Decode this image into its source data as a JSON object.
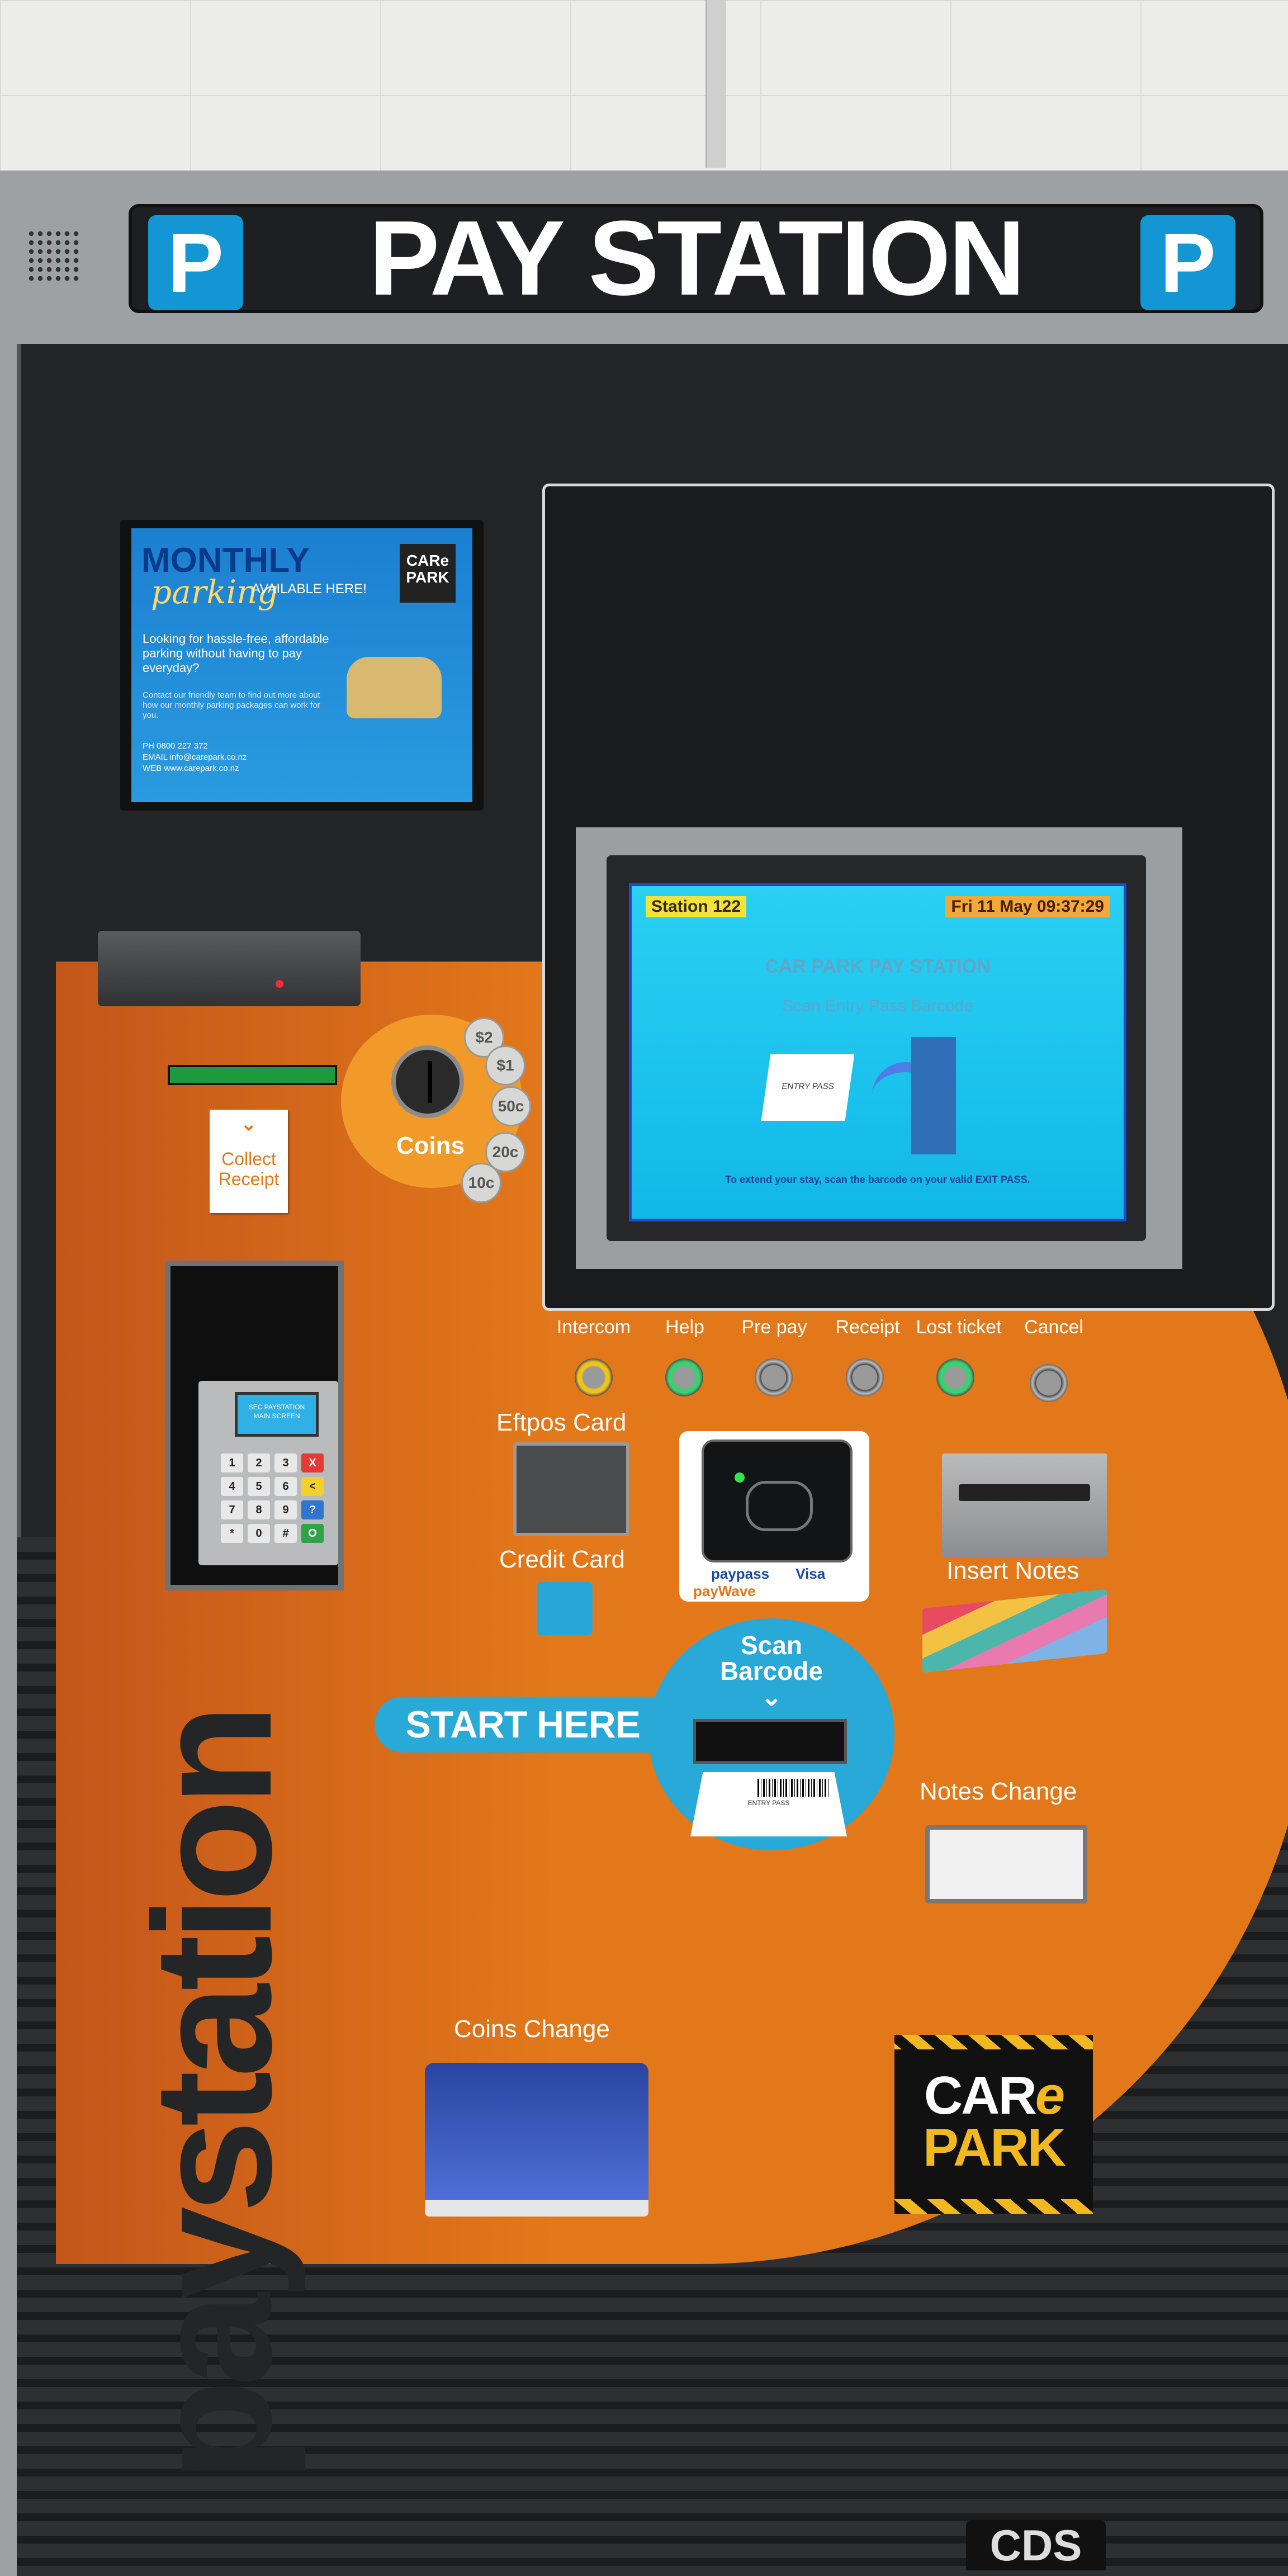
{
  "header": {
    "title": "PAY STATION",
    "parking_symbol": "P"
  },
  "ad": {
    "monthly": "MONTHLY",
    "parking": "parking",
    "available": "AVAILABLE HERE!",
    "logo_line1": "CARe",
    "logo_line2": "PARK",
    "question": "Looking for hassle-free, affordable parking without having to pay everyday?",
    "body": "Contact our friendly team to find out more about how our monthly parking packages can work for you.",
    "phone": "PH 0800 227 372",
    "email": "EMAIL info@carepark.co.nz",
    "web": "WEB www.carepark.co.nz"
  },
  "screen": {
    "station": "Station 122",
    "datetime": "Fri 11 May 09:37:29",
    "title": "CAR PARK PAY STATION",
    "instruction": "Scan Entry Pass Barcode",
    "ticket_text": "ENTRY PASS",
    "footer": "To extend your stay, scan the barcode on your valid EXIT PASS."
  },
  "coins": {
    "label": "Coins",
    "denominations": [
      "$2",
      "$1",
      "50c",
      "20c",
      "10c"
    ]
  },
  "receipt": {
    "label_line1": "Collect",
    "label_line2": "Receipt"
  },
  "keypad": {
    "screen_line1": "SEC PAYSTATION",
    "screen_line2": "MAIN SCREEN",
    "keys": [
      "1",
      "2",
      "3",
      "X",
      "4",
      "5",
      "6",
      "<",
      "7",
      "8",
      "9",
      "?",
      "*",
      "0",
      "#",
      "O"
    ]
  },
  "buttons": [
    {
      "label": "Intercom",
      "icon": "intercom-icon"
    },
    {
      "label": "Help",
      "icon": "help-icon"
    },
    {
      "label": "Pre pay",
      "icon": "prepay-icon"
    },
    {
      "label": "Receipt",
      "icon": "receipt-icon"
    },
    {
      "label": "Lost ticket",
      "icon": "lost-ticket-icon"
    },
    {
      "label": "Cancel",
      "icon": "cancel-icon"
    }
  ],
  "payment": {
    "eftpos": "Eftpos Card",
    "credit": "Credit Card",
    "paypass": "paypass",
    "visa": "Visa",
    "paywave": "payWave",
    "insert_notes": "Insert Notes",
    "notes_change": "Notes Change",
    "coins_change": "Coins Change"
  },
  "start": {
    "start_here": "START HERE",
    "scan_line1": "Scan",
    "scan_line2": "Barcode",
    "ticket_label": "ENTRY PASS"
  },
  "branding": {
    "vertical": "paystation",
    "care": "CAR",
    "care_e": "e",
    "park": "PARK",
    "maker": "CDS"
  },
  "colors": {
    "orange": "#e3781a",
    "blue": "#28a9d8",
    "p_blue": "#1596d4",
    "yellow": "#f2b81f"
  }
}
